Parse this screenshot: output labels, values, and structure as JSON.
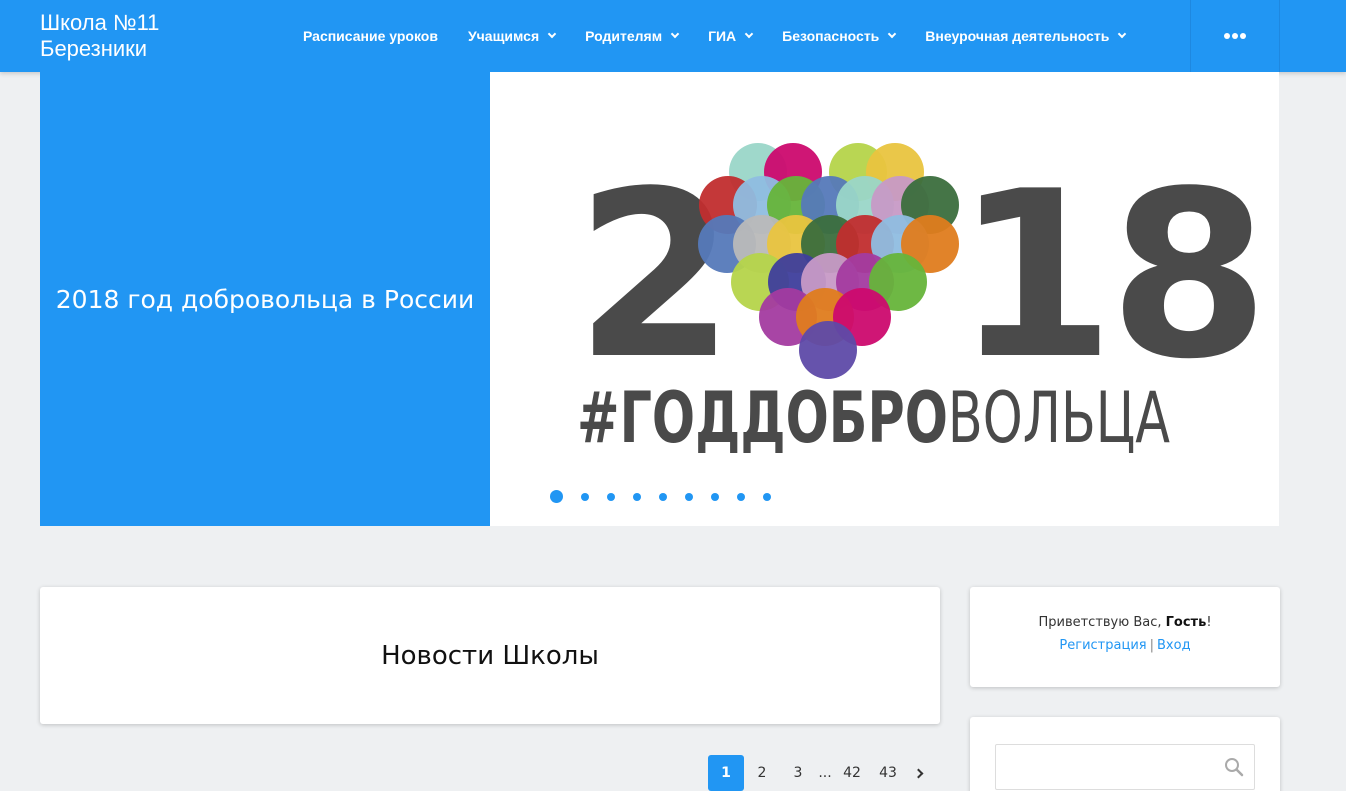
{
  "site": {
    "title_line1": "Школа №11",
    "title_line2": "Березники"
  },
  "nav": {
    "items": [
      {
        "label": "Расписание уроков",
        "has_dropdown": false
      },
      {
        "label": "Учащимся",
        "has_dropdown": true
      },
      {
        "label": "Родителям",
        "has_dropdown": true
      },
      {
        "label": "ГИА",
        "has_dropdown": true
      },
      {
        "label": "Безопасность",
        "has_dropdown": true
      },
      {
        "label": "Внеурочная деятельность",
        "has_dropdown": true
      }
    ],
    "more_icon": "ellipsis-icon"
  },
  "slider": {
    "caption": "2018 год добровольца в России",
    "image": {
      "year_left": "2",
      "year_right": "18",
      "hashtag_dark": "#ГОДДОБРО",
      "hashtag_light": "ВОЛЬЦА"
    },
    "dots_count": 9,
    "active_dot": 1
  },
  "news": {
    "title": "Новости Школы"
  },
  "welcome": {
    "greeting": "Приветствую Вас, ",
    "user": "Гость",
    "exclaim": "!",
    "register_label": "Регистрация",
    "separator": "|",
    "login_label": "Вход"
  },
  "search": {
    "placeholder": "",
    "icon": "search-icon"
  },
  "pagination": {
    "pages": [
      "1",
      "2",
      "3"
    ],
    "ellipsis": "...",
    "last_pages": [
      "42",
      "43"
    ],
    "current": "1"
  },
  "colors": {
    "accent": "#2196f3",
    "background": "#eef0f2",
    "logo_dark": "#4a4a4a"
  }
}
